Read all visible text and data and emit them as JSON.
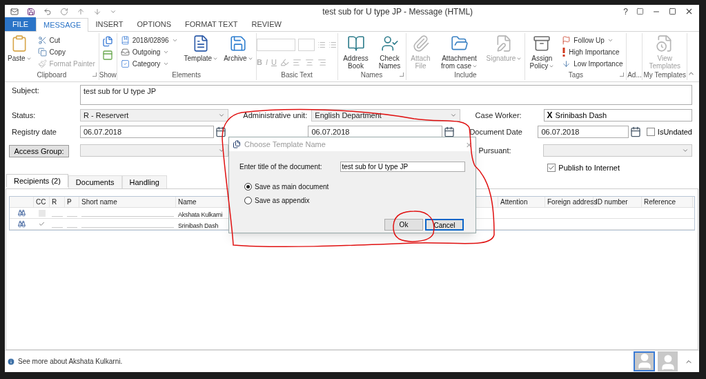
{
  "window": {
    "title": "test sub for U type JP - Message (HTML)",
    "help": "?"
  },
  "tabs": [
    {
      "label": "FILE",
      "kind": "file",
      "selected": false
    },
    {
      "label": "MESSAGE",
      "kind": "tab",
      "selected": true
    },
    {
      "label": "INSERT",
      "kind": "tab",
      "selected": false
    },
    {
      "label": "OPTIONS",
      "kind": "tab",
      "selected": false
    },
    {
      "label": "FORMAT TEXT",
      "kind": "tab",
      "selected": false
    },
    {
      "label": "REVIEW",
      "kind": "tab",
      "selected": false
    }
  ],
  "ribbon": {
    "groups": [
      {
        "label": "Clipboard",
        "launcher": true,
        "items": [
          {
            "label": "Paste",
            "kind": "large",
            "dropdown": true,
            "disabled": false
          },
          {
            "label": "Cut",
            "kind": "small",
            "dropdown": false,
            "disabled": false
          },
          {
            "label": "Copy",
            "kind": "small",
            "dropdown": false,
            "disabled": false
          },
          {
            "label": "Format Painter",
            "kind": "small",
            "dropdown": false,
            "disabled": true
          }
        ]
      },
      {
        "label": "Show",
        "launcher": false,
        "kind": "show"
      },
      {
        "label": "Elements",
        "launcher": false,
        "items": [
          {
            "label": "2018/02896",
            "kind": "small",
            "dropdown": true,
            "disabled": false
          },
          {
            "label": "Outgoing",
            "kind": "small",
            "dropdown": true,
            "disabled": false
          },
          {
            "label": "Category",
            "kind": "small",
            "dropdown": true,
            "disabled": false
          },
          {
            "label": "Template",
            "kind": "large",
            "dropdown": true,
            "disabled": false
          },
          {
            "label": "Archive",
            "kind": "large",
            "dropdown": true,
            "disabled": false
          }
        ]
      },
      {
        "label": "Basic Text",
        "launcher": false,
        "kind": "text",
        "format_buttons": [
          "B",
          "I",
          "U"
        ]
      },
      {
        "label": "Names",
        "launcher": true,
        "items": [
          {
            "label": "Address Book",
            "kind": "large",
            "dropdown": false,
            "disabled": false
          },
          {
            "label": "Check Names",
            "kind": "large",
            "dropdown": false,
            "disabled": false
          }
        ]
      },
      {
        "label": "Include",
        "launcher": false,
        "items": [
          {
            "label": "Attach File",
            "kind": "large",
            "dropdown": false,
            "disabled": true
          },
          {
            "label": "Attachment from case",
            "kind": "large",
            "dropdown": true,
            "disabled": false
          },
          {
            "label": "Signature",
            "kind": "large",
            "dropdown": true,
            "disabled": true
          }
        ]
      },
      {
        "label": "Tags",
        "launcher": true,
        "items": [
          {
            "label": "Assign Policy",
            "kind": "large",
            "dropdown": true,
            "disabled": false
          },
          {
            "label": "Follow Up",
            "kind": "small",
            "dropdown": true,
            "disabled": false
          },
          {
            "label": "High Importance",
            "kind": "small",
            "dropdown": false,
            "disabled": false
          },
          {
            "label": "Low Importance",
            "kind": "small",
            "dropdown": false,
            "disabled": false
          }
        ]
      },
      {
        "label": "Ad...",
        "launcher": false
      },
      {
        "label": "My Templates",
        "launcher": false,
        "items": [
          {
            "label": "View Templates",
            "kind": "large",
            "dropdown": false,
            "disabled": true
          }
        ]
      }
    ]
  },
  "form": {
    "subject": {
      "label": "Subject:",
      "value": "test sub for U type JP"
    },
    "status": {
      "label": "Status:",
      "value": "R - Reservert"
    },
    "administrative_unit": {
      "label": "Administrative unit:",
      "value": "English Department"
    },
    "case_worker": {
      "label": "Case Worker:",
      "remove": "X",
      "value": "Srinibash Dash"
    },
    "registry_date": {
      "label": "Registry date",
      "value": "06.07.2018"
    },
    "received_date": {
      "value": "06.07.2018"
    },
    "document_date": {
      "label": "Document Date",
      "value": "06.07.2018"
    },
    "is_undated": {
      "label": "IsUndated",
      "checked": false
    },
    "access_group": {
      "label": "Access Group:"
    },
    "pursuant": {
      "label": "Pursuant:"
    },
    "publish": {
      "label": "Publish to Internet",
      "checked": true
    }
  },
  "recipient_tabs": [
    {
      "label": "Recipients (2)",
      "selected": true
    },
    {
      "label": "Documents",
      "selected": false
    },
    {
      "label": "Handling",
      "selected": false
    }
  ],
  "table": {
    "columns": [
      "CC",
      "R",
      "P",
      "Short name",
      "Name",
      "Attention",
      "Foreign address",
      "ID number",
      "Reference"
    ],
    "rows": [
      {
        "name": "Akshata Kulkarni",
        "cc_checked": false,
        "cc_disabled": true
      },
      {
        "name": "Srinibash Dash",
        "cc_checked": true,
        "cc_disabled": false
      }
    ]
  },
  "dialog": {
    "title": "Choose Template Name",
    "close": "×",
    "prompt": "Enter title of the document:",
    "value": "test sub for U type JP",
    "options": [
      {
        "label": "Save as main document",
        "selected": true
      },
      {
        "label": "Save as appendix",
        "selected": false
      }
    ],
    "buttons": [
      {
        "label": "Ok",
        "focused": false
      },
      {
        "label": "Cancel",
        "focused": true
      }
    ]
  },
  "status_bar": {
    "text": "See more about Akshata Kulkarni."
  }
}
